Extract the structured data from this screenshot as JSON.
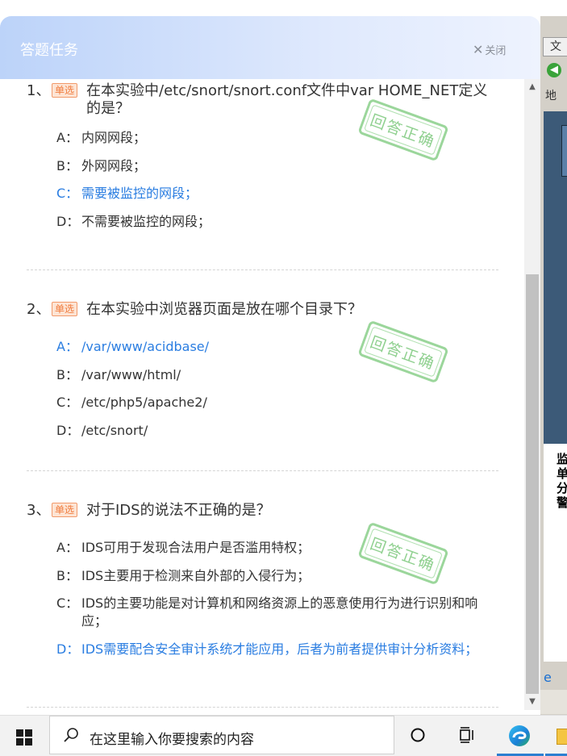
{
  "panel": {
    "title": "答题任务",
    "close_label": "关闭"
  },
  "questions": [
    {
      "number": "1、",
      "tag": "单选",
      "text": "在本实验中/etc/snort/snort.conf文件中var HOME_NET定义的是？",
      "stamp": "回答正确",
      "options": [
        {
          "letter": "A：",
          "text": "内网网段；",
          "correct": false
        },
        {
          "letter": "B：",
          "text": "外网网段；",
          "correct": false
        },
        {
          "letter": "C：",
          "text": "需要被监控的网段；",
          "correct": true
        },
        {
          "letter": "D：",
          "text": "不需要被监控的网段；",
          "correct": false
        }
      ]
    },
    {
      "number": "2、",
      "tag": "单选",
      "text": "在本实验中浏览器页面是放在哪个目录下？",
      "stamp": "回答正确",
      "options": [
        {
          "letter": "A：",
          "text": "/var/www/acidbase/",
          "correct": true
        },
        {
          "letter": "B：",
          "text": "/var/www/html/",
          "correct": false
        },
        {
          "letter": "C：",
          "text": "/etc/php5/apache2/",
          "correct": false
        },
        {
          "letter": "D：",
          "text": "/etc/snort/",
          "correct": false
        }
      ]
    },
    {
      "number": "3、",
      "tag": "单选",
      "text": "对于IDS的说法不正确的是？",
      "stamp": "回答正确",
      "options": [
        {
          "letter": "A：",
          "text": "IDS可用于发现合法用户是否滥用特权；",
          "correct": false
        },
        {
          "letter": "B：",
          "text": "IDS主要用于检测来自外部的入侵行为；",
          "correct": false
        },
        {
          "letter": "C：",
          "text": "IDS的主要功能是对计算机和网络资源上的恶意使用行为进行识别和响应；",
          "correct": false
        },
        {
          "letter": "D：",
          "text": "IDS需要配合安全审计系统才能应用，后者为前者提供审计分析资料；",
          "correct": true
        }
      ]
    }
  ],
  "background_window": {
    "menu_label": "文",
    "address_label": "地",
    "side_text": "监单分警"
  },
  "taskbar": {
    "search_placeholder": "在这里输入你要搜索的内容"
  },
  "colors": {
    "correct_answer": "#2a7de1",
    "tag": "#f07b3d",
    "stamp": "#7cc87c"
  }
}
